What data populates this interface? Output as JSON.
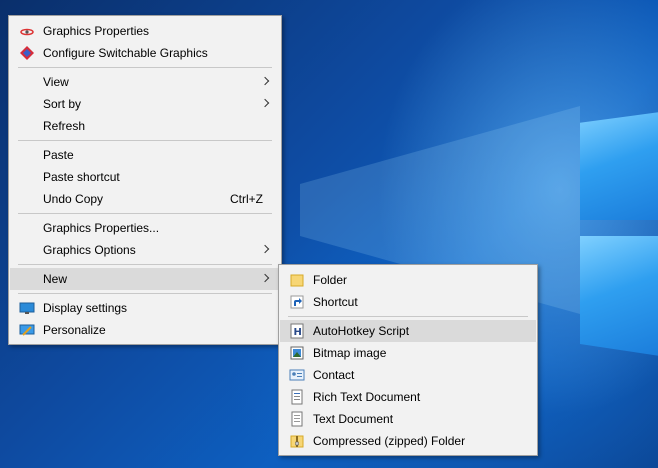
{
  "desktop_menu": {
    "items": [
      {
        "label": "Graphics Properties",
        "icon": "intel-graphics-icon"
      },
      {
        "label": "Configure Switchable Graphics",
        "icon": "switchable-graphics-icon"
      },
      {
        "label": "View",
        "submenu": true
      },
      {
        "label": "Sort by",
        "submenu": true
      },
      {
        "label": "Refresh"
      },
      {
        "label": "Paste"
      },
      {
        "label": "Paste shortcut"
      },
      {
        "label": "Undo Copy",
        "shortcut": "Ctrl+Z"
      },
      {
        "label": "Graphics Properties..."
      },
      {
        "label": "Graphics Options",
        "submenu": true
      },
      {
        "label": "New",
        "submenu": true,
        "highlighted": true
      },
      {
        "label": "Display settings",
        "icon": "display-icon"
      },
      {
        "label": "Personalize",
        "icon": "personalize-icon"
      }
    ]
  },
  "new_submenu": {
    "items": [
      {
        "label": "Folder",
        "icon": "folder-icon"
      },
      {
        "label": "Shortcut",
        "icon": "shortcut-icon"
      },
      {
        "label": "AutoHotkey Script",
        "icon": "autohotkey-script-icon",
        "highlighted": true
      },
      {
        "label": "Bitmap image",
        "icon": "bitmap-image-icon"
      },
      {
        "label": "Contact",
        "icon": "contact-icon"
      },
      {
        "label": "Rich Text Document",
        "icon": "rich-text-document-icon"
      },
      {
        "label": "Text Document",
        "icon": "text-document-icon"
      },
      {
        "label": "Compressed (zipped) Folder",
        "icon": "zip-folder-icon"
      }
    ]
  },
  "colors": {
    "menu_bg": "#f2f2f2",
    "highlight": "#dadada",
    "desktop_accent": "#0e4aa0"
  }
}
